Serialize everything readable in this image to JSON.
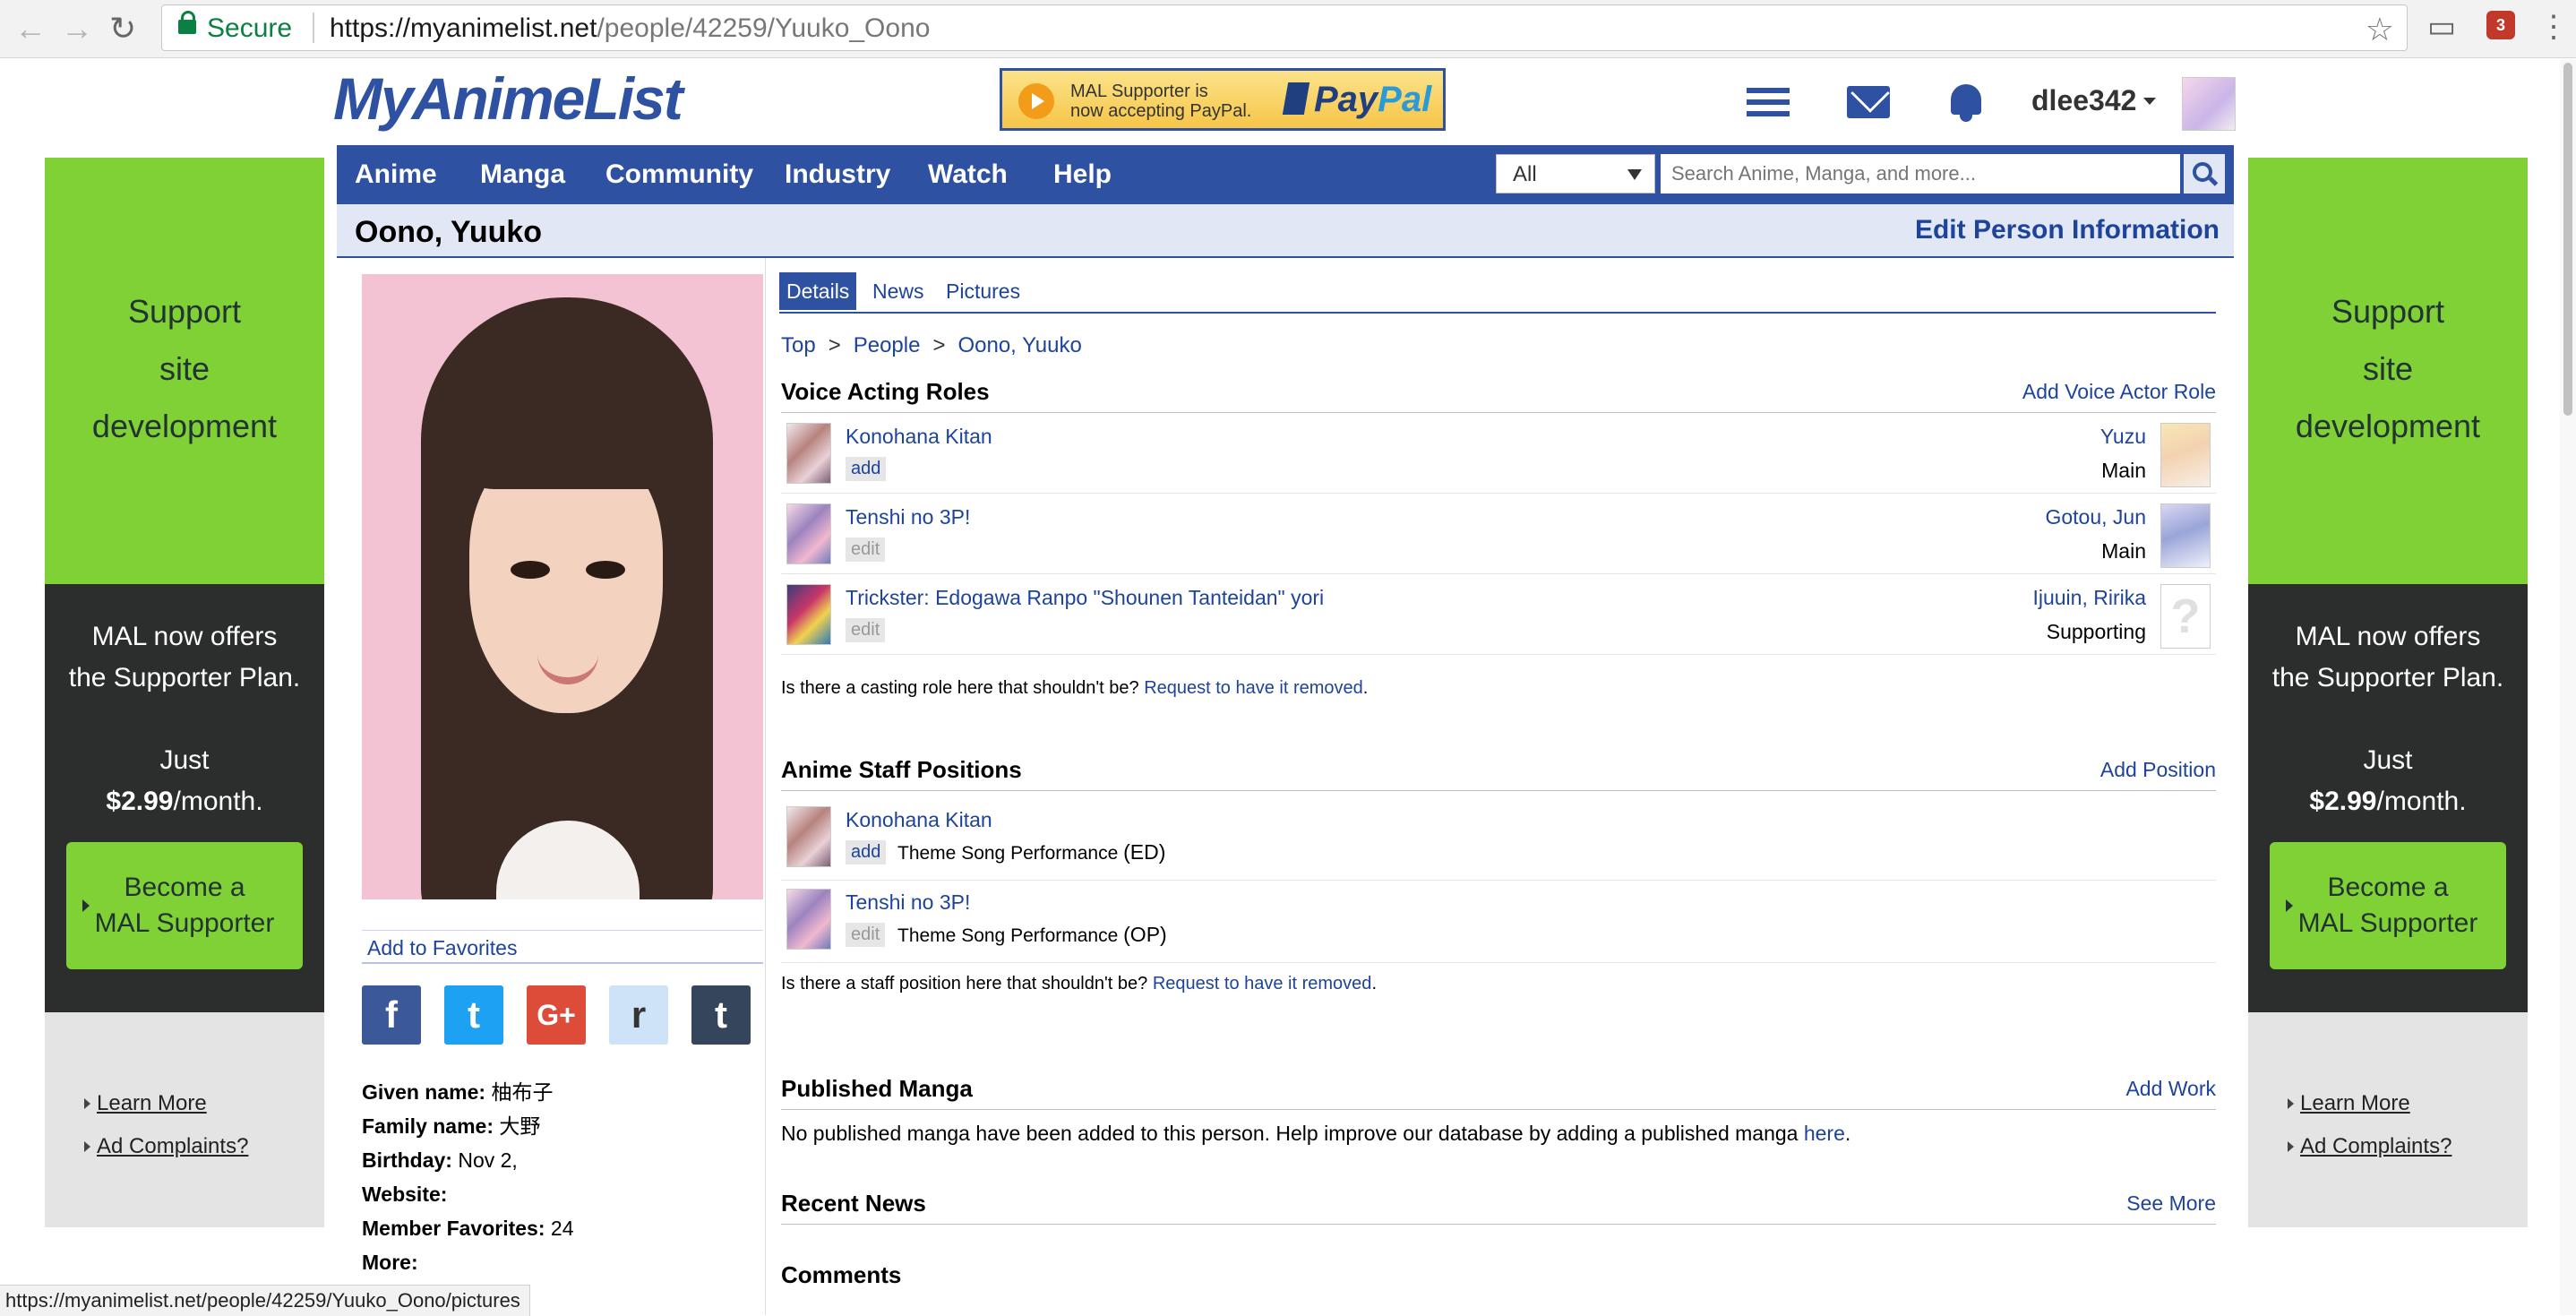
{
  "browser": {
    "secure_label": "Secure",
    "url_host": "https://myanimelist.net",
    "url_path": "/people/42259/Yuuko_Oono",
    "extension_badge": "3",
    "status_url": "https://myanimelist.net/people/42259/Yuuko_Oono/pictures"
  },
  "side_ad": {
    "support_line1": "Support",
    "support_line2": "site",
    "support_line3": "development",
    "offer_line1": "MAL now offers",
    "offer_line2": "the Supporter Plan.",
    "just": "Just",
    "price": "$2.99",
    "per_month": "/month.",
    "become_line1": "Become a",
    "become_line2": "MAL Supporter",
    "learn_more": "Learn More",
    "ad_complaints": "Ad Complaints?"
  },
  "header": {
    "logo": "MyAnimeList",
    "paypal_text_line1": "MAL Supporter is",
    "paypal_text_line2": "now accepting PayPal.",
    "paypal_logo_a": "Pay",
    "paypal_logo_b": "Pal",
    "username": "dlee342"
  },
  "nav": {
    "items": [
      "Anime",
      "Manga",
      "Community",
      "Industry",
      "Watch",
      "Help"
    ],
    "search_category": "All",
    "search_placeholder": "Search Anime, Manga, and more..."
  },
  "page": {
    "title": "Oono, Yuuko",
    "edit_link": "Edit Person Information",
    "add_to_favorites": "Add to Favorites",
    "share_icons": [
      "facebook-icon",
      "twitter-icon",
      "google-plus-icon",
      "reddit-icon",
      "tumblr-icon"
    ],
    "share_glyphs": [
      "f",
      "t",
      "G+",
      "r",
      "t"
    ],
    "info": {
      "given_name_label": "Given name:",
      "given_name": "柚布子",
      "family_name_label": "Family name:",
      "family_name": "大野",
      "birthday_label": "Birthday:",
      "birthday": "Nov 2,",
      "website_label": "Website:",
      "member_favorites_label": "Member Favorites:",
      "member_favorites": "24",
      "more_label": "More:"
    }
  },
  "tabs": [
    "Details",
    "News",
    "Pictures"
  ],
  "breadcrumb": [
    "Top",
    "People",
    "Oono, Yuuko"
  ],
  "breadcrumb_sep": ">",
  "voice_acting": {
    "title": "Voice Acting Roles",
    "action": "Add Voice Actor Role",
    "roles": [
      {
        "anime": "Konohana Kitan",
        "button": "add",
        "character": "Yuzu",
        "role": "Main"
      },
      {
        "anime": "Tenshi no 3P!",
        "button": "edit",
        "character": "Gotou, Jun",
        "role": "Main"
      },
      {
        "anime": "Trickster: Edogawa Ranpo \"Shounen Tanteidan\" yori",
        "button": "edit",
        "character": "Ijuuin, Ririka",
        "role": "Supporting"
      }
    ],
    "note": "Is there a casting role here that shouldn't be?",
    "note_link": "Request to have it removed",
    "unknown_char_glyph": "?"
  },
  "staff": {
    "title": "Anime Staff Positions",
    "action": "Add Position",
    "positions": [
      {
        "anime": "Konohana Kitan",
        "button": "add",
        "position": "Theme Song Performance",
        "tag": "(ED)"
      },
      {
        "anime": "Tenshi no 3P!",
        "button": "edit",
        "position": "Theme Song Performance",
        "tag": "(OP)"
      }
    ],
    "note": "Is there a staff position here that shouldn't be?",
    "note_link": "Request to have it removed"
  },
  "manga": {
    "title": "Published Manga",
    "action": "Add Work",
    "note": "No published manga have been added to this person. Help improve our database by adding a published manga",
    "note_link": "here"
  },
  "news": {
    "title": "Recent News",
    "action": "See More"
  },
  "comments": {
    "title": "Comments"
  },
  "colors": {
    "mal_blue": "#2e51a2",
    "ad_green": "#80d135",
    "ad_dark": "#2c2d2d"
  }
}
